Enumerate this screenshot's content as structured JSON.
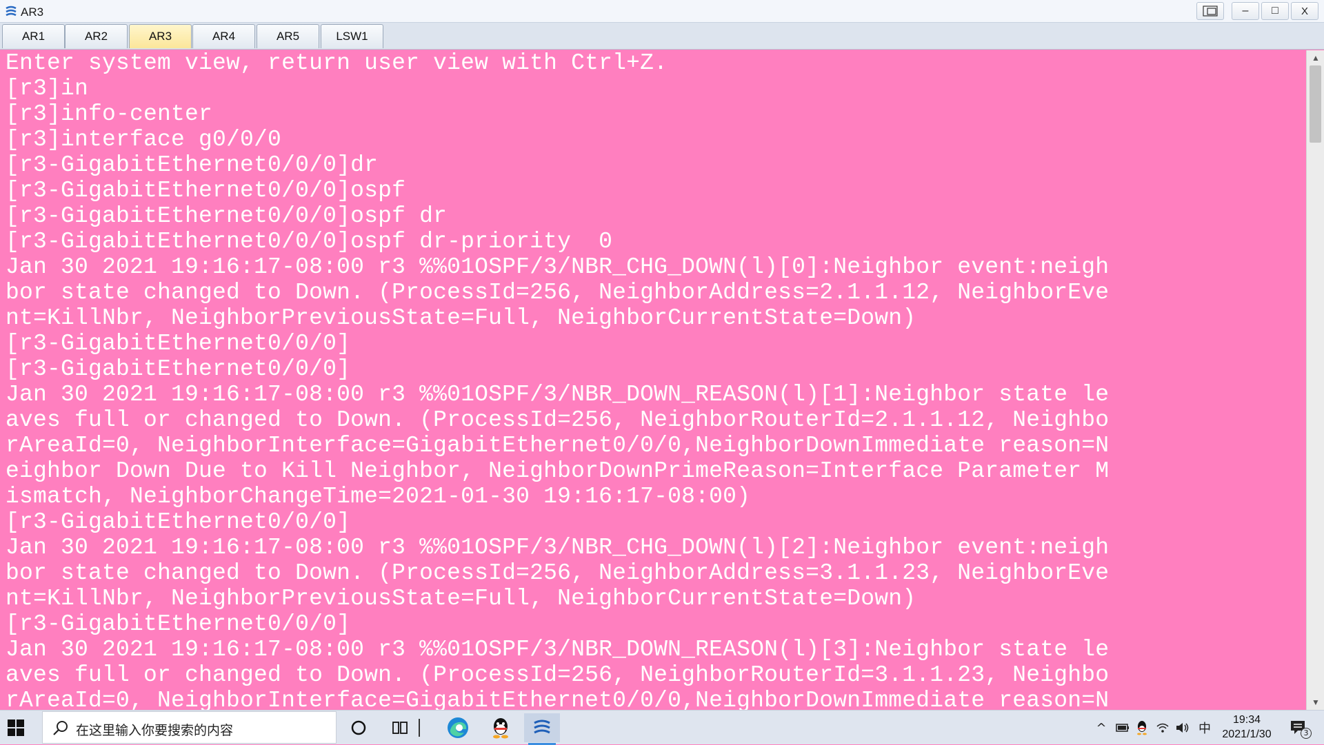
{
  "window": {
    "title": "AR3",
    "buttons": [
      "restore",
      "minimize",
      "maximize",
      "close"
    ],
    "minimize_glyph": "–",
    "maximize_glyph": "□",
    "close_glyph": "X"
  },
  "tabs": [
    {
      "label": "AR1",
      "active": false
    },
    {
      "label": "AR2",
      "active": false
    },
    {
      "label": "AR3",
      "active": true
    },
    {
      "label": "AR4",
      "active": false
    },
    {
      "label": "AR5",
      "active": false
    },
    {
      "label": "LSW1",
      "active": false
    }
  ],
  "terminal": {
    "background": "#ff7fbf",
    "text_color": "#ffffff",
    "lines": [
      "Enter system view, return user view with Ctrl+Z.",
      "[r3]in",
      "[r3]info-center",
      "[r3]interface g0/0/0",
      "[r3-GigabitEthernet0/0/0]dr",
      "[r3-GigabitEthernet0/0/0]ospf",
      "[r3-GigabitEthernet0/0/0]ospf dr",
      "[r3-GigabitEthernet0/0/0]ospf dr-priority  0",
      "Jan 30 2021 19:16:17-08:00 r3 %%01OSPF/3/NBR_CHG_DOWN(l)[0]:Neighbor event:neigh",
      "bor state changed to Down. (ProcessId=256, NeighborAddress=2.1.1.12, NeighborEve",
      "nt=KillNbr, NeighborPreviousState=Full, NeighborCurrentState=Down)",
      "[r3-GigabitEthernet0/0/0]",
      "[r3-GigabitEthernet0/0/0]",
      "Jan 30 2021 19:16:17-08:00 r3 %%01OSPF/3/NBR_DOWN_REASON(l)[1]:Neighbor state le",
      "aves full or changed to Down. (ProcessId=256, NeighborRouterId=2.1.1.12, Neighbo",
      "rAreaId=0, NeighborInterface=GigabitEthernet0/0/0,NeighborDownImmediate reason=N",
      "eighbor Down Due to Kill Neighbor, NeighborDownPrimeReason=Interface Parameter M",
      "ismatch, NeighborChangeTime=2021-01-30 19:16:17-08:00)",
      "[r3-GigabitEthernet0/0/0]",
      "Jan 30 2021 19:16:17-08:00 r3 %%01OSPF/3/NBR_CHG_DOWN(l)[2]:Neighbor event:neigh",
      "bor state changed to Down. (ProcessId=256, NeighborAddress=3.1.1.23, NeighborEve",
      "nt=KillNbr, NeighborPreviousState=Full, NeighborCurrentState=Down)",
      "[r3-GigabitEthernet0/0/0]",
      "Jan 30 2021 19:16:17-08:00 r3 %%01OSPF/3/NBR_DOWN_REASON(l)[3]:Neighbor state le",
      "aves full or changed to Down. (ProcessId=256, NeighborRouterId=3.1.1.23, Neighbo",
      "rAreaId=0, NeighborInterface=GigabitEthernet0/0/0,NeighborDownImmediate reason=N"
    ]
  },
  "scrollbar": {
    "up_glyph": "▲",
    "down_glyph": "▼"
  },
  "taskbar": {
    "search_placeholder": "在这里输入你要搜索的内容",
    "icons": [
      "windows-start-icon",
      "search-icon",
      "cortana-icon",
      "task-view-icon",
      "edge-icon",
      "qq-icon",
      "ensp-icon"
    ],
    "tray": {
      "chevron": "^",
      "ime": "中",
      "time": "19:34",
      "date": "2021/1/30",
      "notification_count": "3"
    }
  }
}
